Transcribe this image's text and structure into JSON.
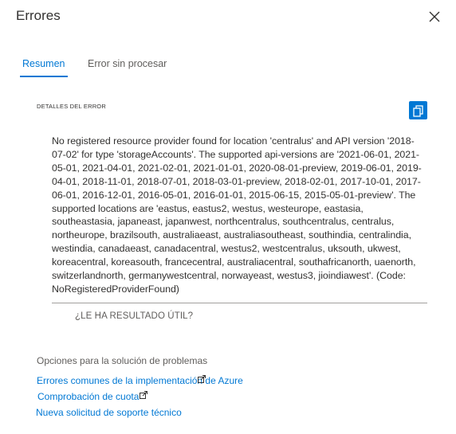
{
  "panel": {
    "title": "Errores"
  },
  "tabs": [
    {
      "label": "Resumen",
      "active": true
    },
    {
      "label": "Error sin procesar",
      "active": false
    }
  ],
  "error_details": {
    "label": "DETALLES DEL ERROR",
    "message": "No registered resource provider found for location 'centralus' and API version '2018-07-02' for type 'storageAccounts'. The supported api-versions are '2021-06-01, 2021-05-01, 2021-04-01, 2021-02-01, 2021-01-01, 2020-08-01-preview, 2019-06-01, 2019-04-01, 2018-11-01, 2018-07-01, 2018-03-01-preview, 2018-02-01, 2017-10-01, 2017-06-01, 2016-12-01, 2016-05-01, 2016-01-01, 2015-06-15, 2015-05-01-preview'. The supported locations are 'eastus, eastus2, westus, westeurope, eastasia, southeastasia, japaneast, japanwest, northcentralus, southcentralus, centralus, northeurope, brazilsouth, australiaeast, australiasoutheast, southindia, centralindia, westindia, canadaeast, canadacentral, westus2, westcentralus, uksouth, ukwest, koreacentral, koreasouth, francecentral, australiacentral, southafricanorth, uaenorth, switzerlandnorth, germanywestcentral, norwayeast, westus3, jioindiawest'. (Code: NoRegisteredProviderFound)"
  },
  "feedback": {
    "question": "¿LE HA RESULTADO ÚTIL?"
  },
  "troubleshooting": {
    "heading": "Opciones para la solución de problemas",
    "links": [
      {
        "label": "Errores comunes de la implementación de Azure"
      },
      {
        "label": "Comprobación de cuota"
      },
      {
        "label": "Nueva solicitud de soporte técnico"
      }
    ]
  },
  "colors": {
    "accent": "#0078d4",
    "text": "#323130",
    "muted": "#605e5c"
  },
  "icons": {
    "close": "close-icon",
    "copy": "copy-icon",
    "external": "external-link-icon"
  }
}
